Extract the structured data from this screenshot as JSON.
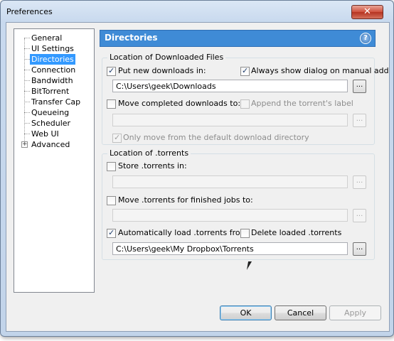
{
  "window": {
    "title": "Preferences",
    "close_glyph": "✕"
  },
  "tree": {
    "items": [
      {
        "label": "General"
      },
      {
        "label": "UI Settings"
      },
      {
        "label": "Directories"
      },
      {
        "label": "Connection"
      },
      {
        "label": "Bandwidth"
      },
      {
        "label": "BitTorrent"
      },
      {
        "label": "Transfer Cap"
      },
      {
        "label": "Queueing"
      },
      {
        "label": "Scheduler"
      },
      {
        "label": "Web UI"
      },
      {
        "label": "Advanced"
      }
    ],
    "selected": "Directories",
    "expander_glyph": "+"
  },
  "header": {
    "title": "Directories",
    "help_glyph": "?"
  },
  "downloads_group": {
    "label": "Location of Downloaded Files",
    "put_new": {
      "label": "Put new downloads in:",
      "checked": true
    },
    "always_show": {
      "label": "Always show dialog on manual add",
      "checked": true
    },
    "download_path": "C:\\Users\\geek\\Downloads",
    "move_completed": {
      "label": "Move completed downloads to:",
      "checked": false
    },
    "append_label": {
      "label": "Append the torrent's label",
      "checked": false
    },
    "completed_path": "",
    "only_move": {
      "label": "Only move from the default download directory",
      "checked": true
    }
  },
  "torrents_group": {
    "label": "Location of .torrents",
    "store": {
      "label": "Store .torrents in:",
      "checked": false
    },
    "store_path": "",
    "move_finished": {
      "label": "Move .torrents for finished jobs to:",
      "checked": false
    },
    "finished_path": "",
    "auto_load": {
      "label": "Automatically load .torrents from:",
      "checked": true
    },
    "delete_loaded": {
      "label": "Delete loaded .torrents",
      "checked": false
    },
    "auto_load_path": "C:\\Users\\geek\\My Dropbox\\Torrents"
  },
  "browse_label": "...",
  "buttons": {
    "ok": "OK",
    "cancel": "Cancel",
    "apply": "Apply"
  }
}
